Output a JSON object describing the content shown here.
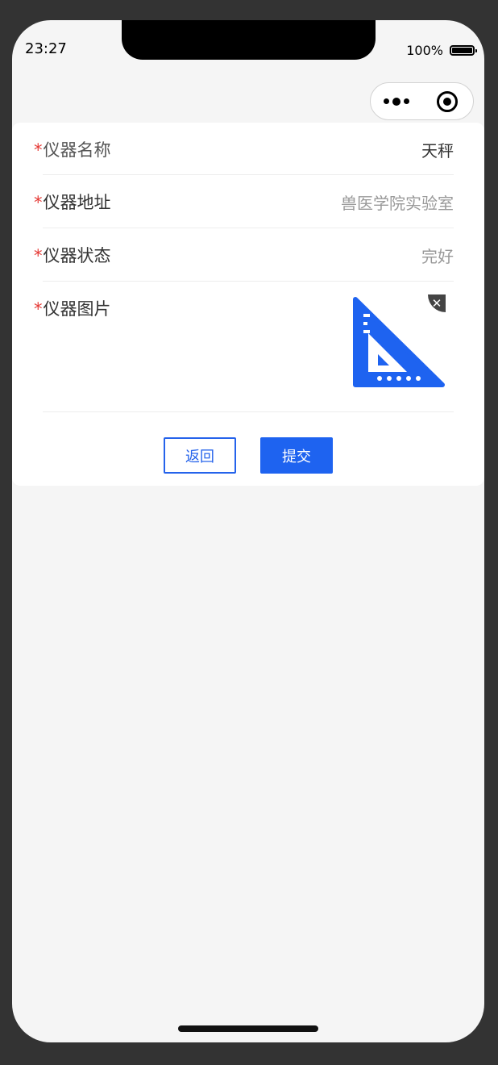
{
  "status_bar": {
    "time": "23:27",
    "battery_percent": "100%"
  },
  "capsule": {
    "more_icon": "more-dots-icon",
    "close_icon": "target-circle-icon"
  },
  "form": {
    "fields": [
      {
        "required_mark": "*",
        "label": "仪器名称",
        "value": "天秤"
      },
      {
        "required_mark": "*",
        "label": "仪器地址",
        "value": "兽医学院实验室"
      },
      {
        "required_mark": "*",
        "label": "仪器状态",
        "value": "完好"
      },
      {
        "required_mark": "*",
        "label": "仪器图片",
        "image_icon": "triangle-ruler-icon",
        "delete_glyph": "✕"
      }
    ]
  },
  "actions": {
    "back_label": "返回",
    "submit_label": "提交"
  },
  "colors": {
    "accent": "#1e63f0",
    "required": "#e53935",
    "background": "#f5f5f5"
  }
}
